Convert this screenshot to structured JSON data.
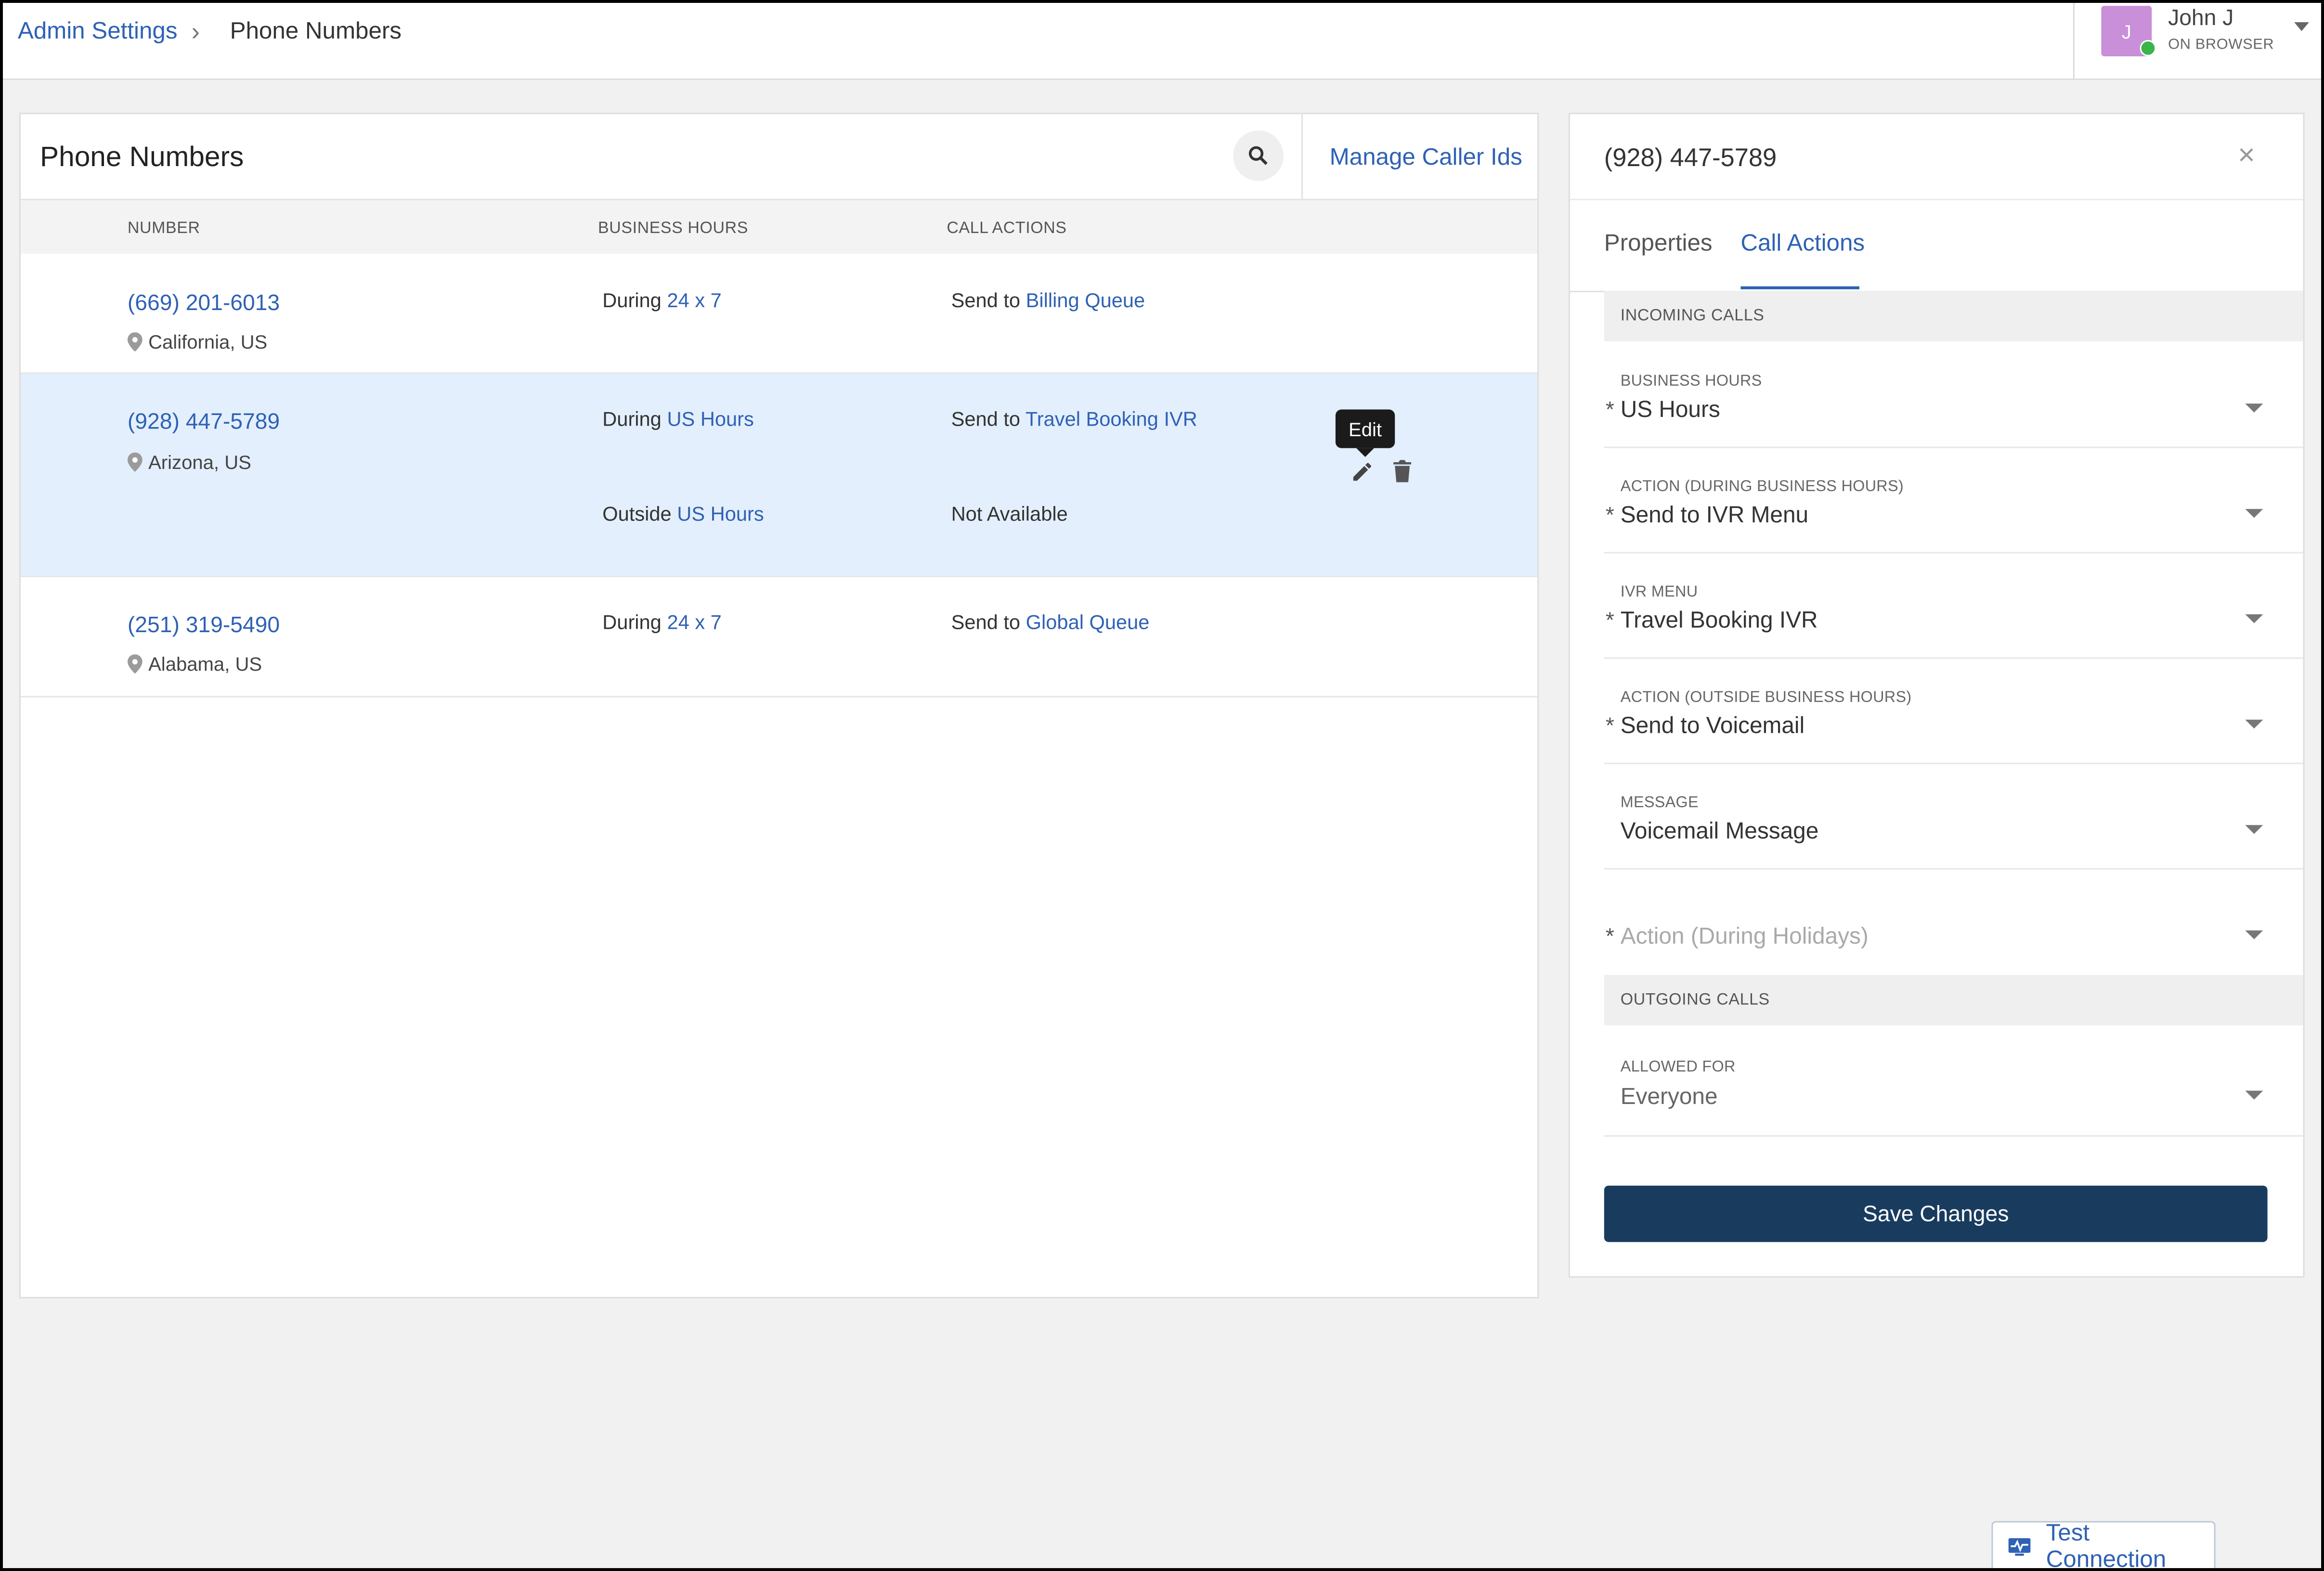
{
  "colors": {
    "accent": "#2f61b5",
    "primary_button": "#193c5e",
    "selected_row": "#e3effc",
    "avatar_bg": "#c98fd8",
    "presence": "#3ab54a"
  },
  "breadcrumb": {
    "root": "Admin Settings",
    "separator": "›",
    "current": "Phone Numbers"
  },
  "user": {
    "initial": "J",
    "name": "John J",
    "status": "ON BROWSER"
  },
  "list": {
    "title": "Phone Numbers",
    "manage_link": "Manage Caller Ids",
    "columns": {
      "number": "NUMBER",
      "business_hours": "BUSINESS HOURS",
      "call_actions": "CALL ACTIONS"
    },
    "rows": [
      {
        "number": "(669) 201-6013",
        "location": "California, US",
        "selected": false,
        "rules": [
          {
            "when": "During",
            "hours": "24 x 7",
            "action_prefix": "Send to",
            "action_target": "Billing Queue"
          }
        ]
      },
      {
        "number": "(928) 447-5789",
        "location": "Arizona, US",
        "selected": true,
        "rules": [
          {
            "when": "During",
            "hours": "US Hours",
            "action_prefix": "Send to",
            "action_target": "Travel Booking IVR"
          },
          {
            "when": "Outside",
            "hours": "US Hours",
            "action_text": "Not Available"
          }
        ]
      },
      {
        "number": "(251) 319-5490",
        "location": "Alabama, US",
        "selected": false,
        "rules": [
          {
            "when": "During",
            "hours": "24 x 7",
            "action_prefix": "Send to",
            "action_target": "Global Queue"
          }
        ]
      }
    ],
    "row_actions": {
      "edit_tooltip": "Edit"
    }
  },
  "detail": {
    "title": "(928) 447-5789",
    "close": "×",
    "tabs": [
      {
        "label": "Properties",
        "active": false
      },
      {
        "label": "Call Actions",
        "active": true
      }
    ],
    "incoming_header": "INCOMING CALLS",
    "outgoing_header": "OUTGOING CALLS",
    "fields": {
      "business_hours": {
        "label": "BUSINESS HOURS",
        "value": "US Hours",
        "required": true
      },
      "action_during": {
        "label": "ACTION (DURING BUSINESS HOURS)",
        "value": "Send to IVR Menu",
        "required": true
      },
      "ivr_menu": {
        "label": "IVR MENU",
        "value": "Travel Booking IVR",
        "required": true
      },
      "action_outside": {
        "label": "ACTION (OUTSIDE BUSINESS HOURS)",
        "value": "Send to Voicemail",
        "required": true
      },
      "message": {
        "label": "MESSAGE",
        "value": "Voicemail Message",
        "required": false
      },
      "action_holidays": {
        "placeholder": "Action (During Holidays)",
        "required": true
      },
      "allowed_for": {
        "label": "ALLOWED FOR",
        "value": "Everyone",
        "required": false
      }
    },
    "required_marker": "*",
    "save_label": "Save Changes"
  },
  "footer": {
    "test_connection": "Test Connection"
  }
}
